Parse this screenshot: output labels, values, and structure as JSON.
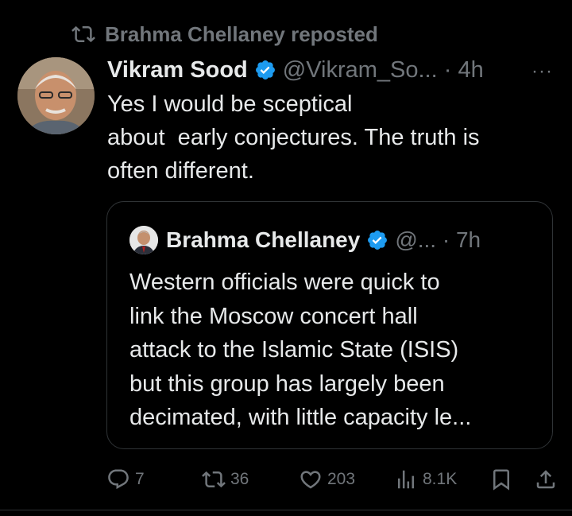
{
  "repost": {
    "text": "Brahma Chellaney reposted",
    "icon": "repost-icon"
  },
  "tweet": {
    "author_name": "Vikram Sood",
    "handle": "@Vikram_So...",
    "time": "4h",
    "more_label": "···",
    "text_lines": [
      "Yes I would be sceptical",
      "about  early conjectures. The truth is",
      "often different."
    ],
    "verified_color": "#1d9bf0"
  },
  "quote": {
    "author_name": "Brahma Chellaney",
    "handle": "@...",
    "time": "7h",
    "text_lines": [
      "Western officials were quick to",
      "link the Moscow concert hall",
      "attack to the Islamic State (ISIS)",
      "but this group has largely been",
      "decimated, with little capacity le..."
    ]
  },
  "actions": {
    "replies": "7",
    "reposts": "36",
    "likes": "203",
    "views": "8.1K"
  },
  "colors": {
    "background": "#000000",
    "text": "#e7e9ea",
    "muted": "#71767b",
    "border": "#2f3336",
    "accent": "#1d9bf0"
  }
}
